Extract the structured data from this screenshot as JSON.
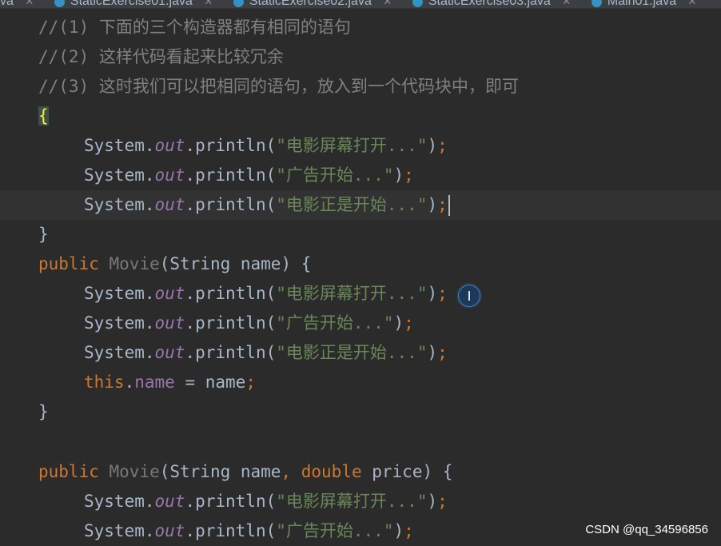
{
  "tabs": [
    {
      "label": "va"
    },
    {
      "label": "StaticExercise01.java"
    },
    {
      "label": "StaticExercise02.java"
    },
    {
      "label": "StaticExercise03.java"
    },
    {
      "label": "Main01.java"
    }
  ],
  "code": {
    "comment1": "//(1) 下面的三个构造器都有相同的语句",
    "comment2": "//(2) 这样代码看起来比较冗余",
    "comment3": "//(3) 这时我们可以把相同的语句，放入到一个代码块中，即可",
    "open_brace": "{",
    "close_brace": "}",
    "system": "System.",
    "out": "out",
    "println": ".println(",
    "close_paren": ")",
    "semicolon": ";",
    "str1": "\"电影屏幕打开...\"",
    "str2": "\"广告开始...\"",
    "str3": "\"电影正是开始...\"",
    "kw_public": "public",
    "ctor_name": "Movie",
    "params1": "(String name) {",
    "params2_a": "(String name",
    "comma": ", ",
    "kw_double": "double",
    "params2_b": " price) {",
    "kw_this": "this",
    "dot": ".",
    "name_field": "name",
    "assign": " = name"
  },
  "watermark": "CSDN @qq_34596856",
  "colors": {
    "background": "#2b2b2b",
    "keyword": "#cc7832",
    "string": "#6a8759",
    "field": "#9876aa",
    "comment": "#808080",
    "text": "#a9b7c6"
  }
}
